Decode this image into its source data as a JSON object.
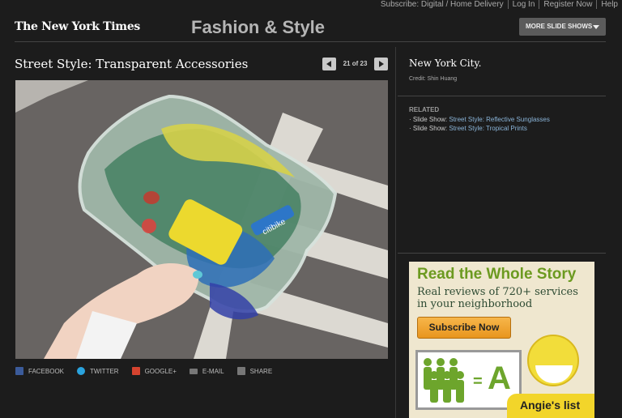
{
  "topnav": [
    "Subscribe: Digital / Home Delivery",
    "Log In",
    "Register Now",
    "Help"
  ],
  "header": {
    "logo": "The New York Times",
    "section": "Fashion & Style",
    "more_button": "MORE SLIDE SHOWS"
  },
  "slide": {
    "title": "Street Style: Transparent Accessories",
    "counter": "21 of 23",
    "caption": "New York City.",
    "credit": "Credit: Shin Huang"
  },
  "share": [
    "FACEBOOK",
    "TWITTER",
    "GOOGLE+",
    "E-MAIL",
    "SHARE"
  ],
  "related": {
    "label": "RELATED",
    "items": [
      {
        "prefix": "Slide Show: ",
        "link": "Street Style: Reflective Sunglasses"
      },
      {
        "prefix": "Slide Show: ",
        "link": "Street Style: Tropical Prints"
      }
    ]
  },
  "ad": {
    "headline": "Read the Whole Story",
    "subtext": "Real reviews of 720+ services in your neighborhood",
    "button": "Subscribe Now",
    "grade": "A",
    "equals": "=",
    "brand": "Angie's list"
  },
  "colors": {
    "background": "#1c1c1c",
    "link": "#8ab4d8",
    "ad_green": "#6c9a20",
    "ad_button": "#f0a533"
  },
  "photo": {
    "bag_label": "citibike"
  }
}
